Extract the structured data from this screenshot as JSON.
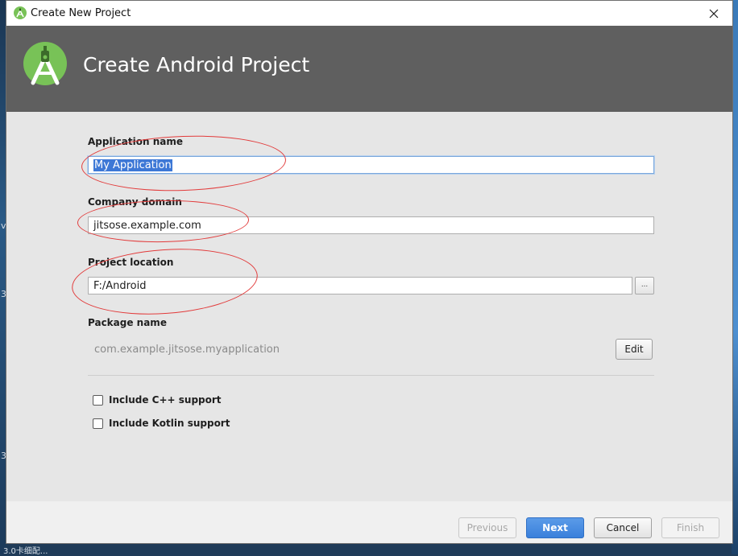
{
  "window": {
    "title": "Create New Project",
    "close_glyph": "✕"
  },
  "banner": {
    "title": "Create Android Project",
    "logo_icon": "android-studio-logo-icon"
  },
  "form": {
    "application_name": {
      "label": "Application name",
      "value": "My Application"
    },
    "company_domain": {
      "label": "Company domain",
      "value": "jitsose.example.com"
    },
    "project_location": {
      "label": "Project location",
      "value": "F:/Android",
      "browse_label": "..."
    },
    "package_name": {
      "label": "Package name",
      "value": "com.example.jitsose.myapplication",
      "edit_label": "Edit"
    },
    "options": [
      {
        "label": "Include C++ support",
        "checked": false
      },
      {
        "label": "Include Kotlin support",
        "checked": false
      }
    ]
  },
  "footer": {
    "previous": "Previous",
    "next": "Next",
    "cancel": "Cancel",
    "finish": "Finish"
  },
  "background": {
    "fragments": [
      "v",
      "3",
      "3",
      "3.0卡细配..."
    ]
  },
  "colors": {
    "banner": "#5f5f5f",
    "primary_button": "#3a80db",
    "annotation": "#e23b3b",
    "selection": "#3d78d6"
  }
}
